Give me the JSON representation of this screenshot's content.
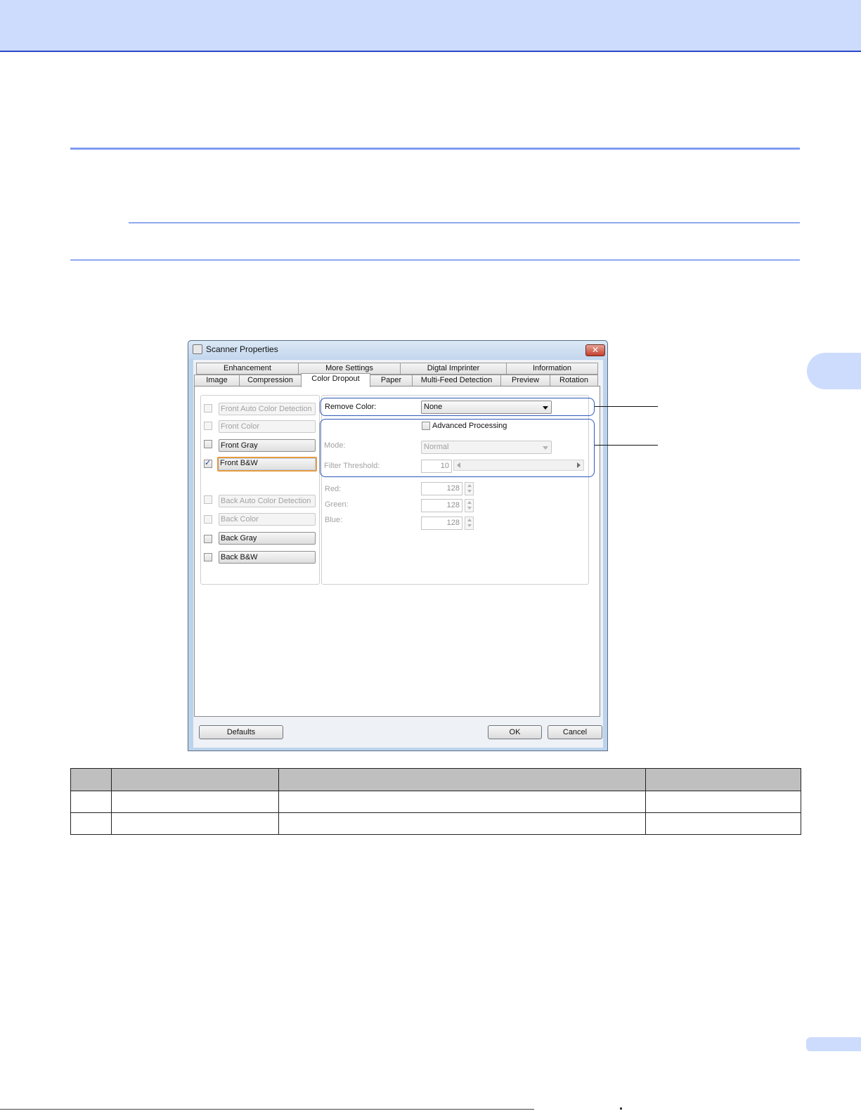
{
  "dialog": {
    "title": "Scanner Properties",
    "close_glyph": "✕",
    "tabs_row1": [
      "Enhancement",
      "More Settings",
      "Digtal Imprinter",
      "Information"
    ],
    "tabs_row2": [
      "Image",
      "Compression",
      "Color Dropout",
      "Paper",
      "Multi-Feed Detection",
      "Preview",
      "Rotation"
    ],
    "active_tab": "Color Dropout",
    "image_types": [
      {
        "label": "Front Auto Color Detection",
        "checked": false,
        "enabled": false
      },
      {
        "label": "Front Color",
        "checked": false,
        "enabled": false
      },
      {
        "label": "Front Gray",
        "checked": false,
        "enabled": true
      },
      {
        "label": "Front B&W",
        "checked": true,
        "enabled": true
      },
      {
        "label": "Back Auto Color Detection",
        "checked": false,
        "enabled": false
      },
      {
        "label": "Back Color",
        "checked": false,
        "enabled": false
      },
      {
        "label": "Back Gray",
        "checked": false,
        "enabled": true
      },
      {
        "label": "Back B&W",
        "checked": false,
        "enabled": true
      }
    ],
    "remove_color": {
      "label": "Remove Color:",
      "value": "None"
    },
    "advanced_processing": {
      "label": "Advanced Processing",
      "checked": false
    },
    "mode": {
      "label": "Mode:",
      "value": "Normal"
    },
    "filter_threshold": {
      "label": "Filter Threshold:",
      "value": "10"
    },
    "rgb": [
      {
        "label": "Red:",
        "value": "128"
      },
      {
        "label": "Green:",
        "value": "128"
      },
      {
        "label": "Blue:",
        "value": "128"
      }
    ],
    "buttons": {
      "defaults": "Defaults",
      "ok": "OK",
      "cancel": "Cancel"
    }
  },
  "colors": {
    "header_band": "#cddcfd",
    "callout_border": "#2d58b8",
    "focus_orange": "#e79a40"
  }
}
